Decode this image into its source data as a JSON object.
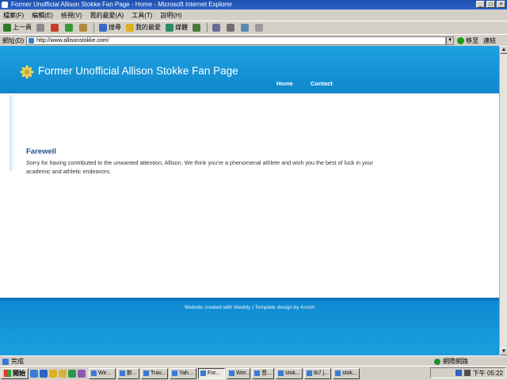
{
  "window": {
    "title": "Former Unofficial Allison Stokke Fan Page - Home - Microsoft Internet Explorer"
  },
  "menu": [
    "檔案(F)",
    "編輯(E)",
    "檢視(V)",
    "我的最愛(A)",
    "工具(T)",
    "說明(H)"
  ],
  "toolbar": {
    "back_label": "上一頁",
    "search_label": "搜尋",
    "favorites_label": "我的最愛",
    "media_label": "媒體"
  },
  "address": {
    "label": "網址(D)",
    "url": "http://www.allisonstokke.com/",
    "go_label": "移至",
    "links_label": "連結"
  },
  "site": {
    "title": "Former Unofficial Allison Stokke Fan Page",
    "nav_home": "Home",
    "nav_contact": "Contact",
    "heading": "Farewell",
    "body": "Sorry for having contributed to the unwanted attention, Allison.  We think you're a phenomenal athlete and wish you the best of luck in your academic and athletic endeavors.",
    "footer": "Website created with Weebly | Template design by Arcsin"
  },
  "status": {
    "left": "完成",
    "zone": "網際網路"
  },
  "taskbar": {
    "start_label": "開始",
    "tasks": [
      "Wir...",
      "新...",
      "Trav...",
      "Yah...",
      "For...",
      "Wm...",
      "音...",
      "stok...",
      "tb7.j...",
      "stok..."
    ],
    "clock": "下午 05:22"
  },
  "colors": {
    "header": "#1ea2e0",
    "heading": "#1e4f8e"
  }
}
